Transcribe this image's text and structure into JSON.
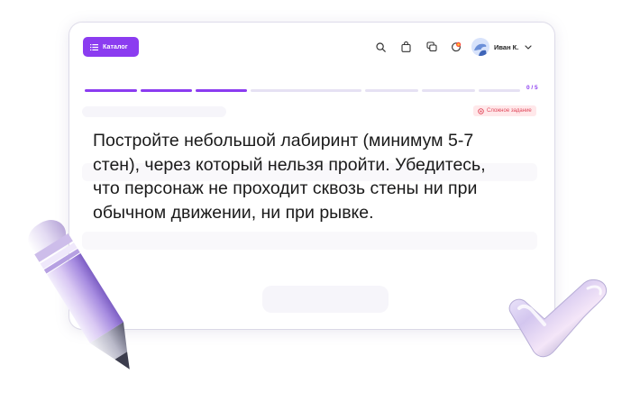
{
  "header": {
    "catalog_label": "Каталог",
    "user_name": "Иван К."
  },
  "icons": {
    "menu": "menu-icon",
    "search": "search-icon",
    "bag": "bag-icon",
    "chat": "chat-icon",
    "notifications": "notification-icon",
    "chevron": "chevron-down-icon"
  },
  "progress": {
    "completed_segments": 3,
    "total_segments": 8,
    "counter_text": "0 / 5"
  },
  "task": {
    "difficulty_label": "Сложное задание",
    "text": "Постройте небольшой лабиринт (минимум 5-7 стен), через который нельзя пройти. Убедитесь, что персонаж не проходит сквозь стены ни при обычном движении, ни при рывке."
  },
  "colors": {
    "accent": "#8b3cf0",
    "progress_done": "#8b3cf0",
    "progress_todo": "#e6e1f3",
    "badge_bg": "#ffe8ea",
    "badge_text": "#e0475a"
  }
}
